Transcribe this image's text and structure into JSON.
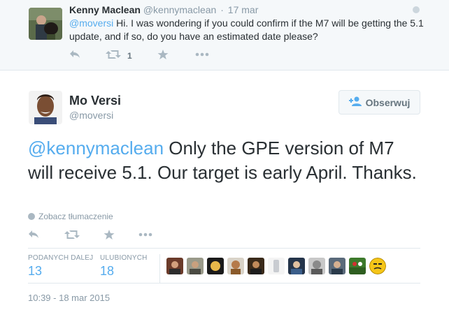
{
  "reply": {
    "name": "Kenny Maclean",
    "handle": "@kennymaclean",
    "dot": "·",
    "date": "17 mar",
    "mention": "@moversi",
    "text": " Hi. I was wondering if you could confirm if the M7 will be getting the 5.1 update, and if so, do you have an estimated date please?",
    "retweet_count": "1"
  },
  "tweet": {
    "name": "Mo Versi",
    "handle": "@moversi",
    "follow_label": "Obserwuj",
    "mention": "@kennymaclean",
    "text": " Only the GPE version of M7 will receive 5.1. Our target is early April. Thanks.",
    "translate_label": "Zobacz tłumaczenie",
    "retweets_label": "PODANYCH DALEJ",
    "retweets_value": "13",
    "favorites_label": "ULUBIONYCH",
    "favorites_value": "18",
    "timestamp": "10:39 - 18 mar 2015"
  },
  "colors": {
    "link": "#55acee",
    "muted": "#8899a6",
    "icon": "#aab8c2",
    "text": "#292f33"
  }
}
